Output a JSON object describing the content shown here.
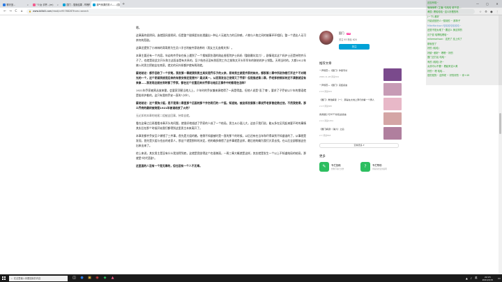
{
  "tabs": [
    {
      "label": "聊天室…",
      "color": "#2a7ae2",
      "active": false
    },
    {
      "label": "\"少女 手杯…(m)",
      "color": "#f25d8e",
      "active": false
    },
    {
      "label": "国门 - 搜索结果 - 哔哩哔哩弹幕",
      "color": "#00a1d6",
      "active": false
    },
    {
      "label": "霸气侧漏的男人—…(国门)",
      "color": "#00a1d6",
      "active": true
    }
  ],
  "window_buttons": {
    "min": "—",
    "max": "▢",
    "close": "✕"
  },
  "address": {
    "url_host": "www.bilibili.com",
    "url_path": "/read/cv9578828?from=search",
    "back": "←",
    "forward": "→",
    "reload": "C",
    "home": "⌂",
    "star": "☆",
    "ext": "⚙",
    "profile": "●",
    "menu": "⋮"
  },
  "article": {
    "paragraphs": [
      {
        "text": "嗯。",
        "style": "normal"
      },
      {
        "text": "这章真的很阴间，造就国风很阴间，但是整个剧情里处处透露出一种让人无能为力的压抑感，人物与人物之间的故事环环相扣，整一个透出人无可奈何的悲剧。",
        "style": "normal"
      },
      {
        "text": "这章还提到了小林林的哥哥原为生灵八字古利被齐家收养的（男女主无血缘关系）。",
        "style": "normal"
      },
      {
        "text": "本章主要还有一个内容，年幼的齐乔安在街上遇到了一个搜城索伤酒的刚走香医院护士妈妈（整剧最坑笑刀），剧情现实这个妈护士还是持院齐乐子了，也就是说此文开头和主这段该是有关系的，至少结合还没有到医院工作之前和文开头叩早年的联结的护士钥匙，天明当时的。大都1912年嫁入时男主把她女在南家，就文的另外如都护就有两则就。",
        "style": "normal"
      },
      {
        "text": "疑老结论：都手回收了一个伏笔，我发第一章就猜到男主其实是乔乐子的父亲，原来男主就是齐家的妹夫，都那第二章中所说你想打开这个不对眼光的一个，这个阴谋到底是后来的有意安排还是意外？疑点其一，从而我发自己觉得又了乔家？但是描述第二章，乔老爹前情如何还不满意就没有来拿……我发现这就合到时都了乔家，都在这个位置后来对乔家与她反正事件中的都是在怎样？",
        "style": "bold"
      },
      {
        "text": "1921年乔家被黑丛放来雷，会要家顶替当地儿上，少年时的乔安兼来源就得了一具是得盖，但他人说是\"丢了魂\"，要求了子乔安以少年的俄语就是陪伴护着的，这只有我的乔安一直叫\"小伙\"。",
        "style": "normal"
      },
      {
        "text": "疑老结论：这个黄狗小狐，是不是第二章里那个后面的那个齐伤哥们的一个狐，知道她，被迫将发展第二章说乔老爹曾经救过他，不然我觉得，那么乔府的最终被烧是1921年被谁给放了火的？",
        "style": "bold"
      },
      {
        "text": "无论如何本章的结尾二组被这回事，持育自就。",
        "style": "gray"
      },
      {
        "text": "看在这章之后再看看本章开头的问题，就很好地描述了乔家的人成了一个结局，男主从小孤儿大，这由于我们说，能从多在见死起来要不时的事情其实后在那个时候开始我们都得到这里男主本来离开了。",
        "style": "normal"
      },
      {
        "text": "本章发都齐乔安至少做错了三件事，首先是大姐的婚，他倒不知道被时是一直的那个的时候，以后还有在当年和吓得拿到不知道谁的了，从事就是发现，首先是大姐与也去的老家人，那这个就是那样的决定，他的确多做错了这件事就是这样，最后他的确为我们大家去找，在以后全部都放这些出来出来了。",
        "style": "normal"
      },
      {
        "text": "综上来说，其实男主是没有什么我觉得到底，这就是我觉得这个也很美丽，一两三章大概就是这样，其实就是发生一个以上不知道结局的结局，那就是\"时代悲剧\"。",
        "style": "normal"
      },
      {
        "text": "这里面的人没有一个是无辜的，但也没有一个人不无辜。",
        "style": "bold"
      }
    ]
  },
  "author": {
    "name": "国门",
    "level": "LV6",
    "stats": "关注 93    粉丝 620",
    "follow_label": "关注"
  },
  "recommend": {
    "title": "推荐文章",
    "items": [
      {
        "title": "一声惊雷—《国门》作者专访",
        "meta": "2020-11-28 阅读324",
        "thumb": "#7a4a8c"
      },
      {
        "title": "一声惊雷—《国门》完结感言",
        "meta": "2-10 阅读621",
        "thumb": "#c79bb5"
      },
      {
        "title": "《国门》角色解读（一）：那是在大地上穿行的第一个男人",
        "meta": "2-13 阅读845",
        "thumb": "#e8b8c8"
      },
      {
        "title": "香香铺子与2077的实战感言",
        "meta": "2-11 阅读1254",
        "thumb": "#d4a5a5"
      },
      {
        "title": "《国门解读》（第六）之后",
        "meta": "2-7 阅读863",
        "thumb": "#b07f9e"
      }
    ],
    "more_label": "查看更多 ▾"
  },
  "more": {
    "title": "更多",
    "items": [
      {
        "name": "专栏投稿",
        "desc": "想你写专栏文章",
        "icon": "✎"
      },
      {
        "name": "专栏帮助",
        "desc": "查看专栏使用说明",
        "icon": "?"
      }
    ]
  },
  "chat": {
    "lines": [
      {
        "text": "还没有啦~",
        "color": "#2a9d2a"
      },
      {
        "text": "嗨嗨嗨啊 (主播) 哈哈哈 都不是…",
        "color": "#2a9d2a"
      },
      {
        "text": "黄辰: 嗯哈哈哈~这么好看的吗",
        "color": "#2a9d2a"
      },
      {
        "text": "(一下) 都好",
        "color": "#2a9d2a"
      },
      {
        "text": "只能说是把人~想到的 ~ 那阵子",
        "color": "#2a9d2a"
      },
      {
        "text": "MikeMarkson 哈哈哈哈哈哈哈~",
        "color": "#6aa0d0"
      },
      {
        "text": "还是不是太难了~要这么 美这样的",
        "color": "#2a9d2a"
      },
      {
        "text": "月下影 哈啊哈嗯哈~",
        "color": "#2a9d2a"
      },
      {
        "text": "mikemarkson：这完了 没上传了",
        "color": "#2a9d2a"
      },
      {
        "text": "那就是了",
        "color": "#2a9d2a"
      },
      {
        "text": "好的 (哈哈)",
        "color": "#2a9d2a"
      },
      {
        "text": "好欧~都好~ 嗯嗯~ 好的",
        "color": "#2a9d2a"
      },
      {
        "text": "国门正打乱 哈哈~",
        "color": "#2a9d2a"
      },
      {
        "text": "有的 (啦啦) 好~",
        "color": "#2a9d2a"
      },
      {
        "text": "女孩可以不要~ 看起来这么美",
        "color": "#2a9d2a"
      },
      {
        "text": "好的~ 嗯 哈哈…",
        "color": "#2a9d2a"
      },
      {
        "text": "是的是的~ 这样呢 ~ 好的好的 ~ 你+49",
        "color": "#2a9d2a"
      }
    ]
  },
  "taskbar": {
    "search_placeholder": "在这里输入你要搜索的内容",
    "search_icon": "⌕",
    "apps": [
      {
        "glyph": "◫",
        "color": "#fff"
      },
      {
        "glyph": "●",
        "color": "#2a7ae2"
      },
      {
        "glyph": "▣",
        "color": "#f0c040"
      },
      {
        "glyph": "◉",
        "color": "#e04040"
      },
      {
        "glyph": "◆",
        "color": "#2dbe60"
      },
      {
        "glyph": "▲",
        "color": "#f25d8e"
      }
    ],
    "time": "22:15",
    "date": "2021/2/15",
    "lang": "英"
  }
}
